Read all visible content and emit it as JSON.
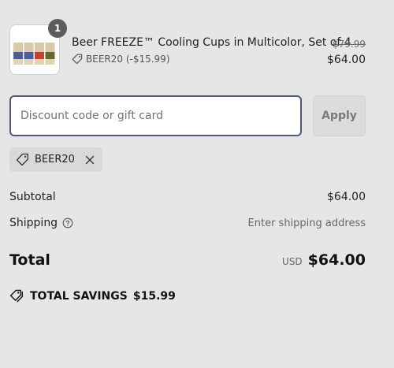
{
  "cart": {
    "item": {
      "quantity": "1",
      "title": "Beer FREEZE™ Cooling Cups in Multicolor, Set of 4",
      "discount_label": "BEER20 (-$15.99)",
      "compare_price": "$79.99",
      "price": "$64.00",
      "cup_colors": [
        "#4a5f8c",
        "#4b5f9a",
        "#c0432b",
        "#5f6a2c"
      ],
      "icon": "tag-icon"
    }
  },
  "discount": {
    "placeholder": "Discount code or gift card",
    "value": "",
    "apply_label": "Apply",
    "applied_code": "BEER20",
    "remove_icon": "close-icon"
  },
  "summary": {
    "subtotal_label": "Subtotal",
    "subtotal_value": "$64.00",
    "shipping_label": "Shipping",
    "shipping_value": "Enter shipping address",
    "shipping_help_icon": "help-circle-icon",
    "total_label": "Total",
    "currency": "USD",
    "total_value": "$64.00",
    "savings_label": "TOTAL SAVINGS",
    "savings_value": "$15.99",
    "savings_icon": "tags-icon"
  }
}
